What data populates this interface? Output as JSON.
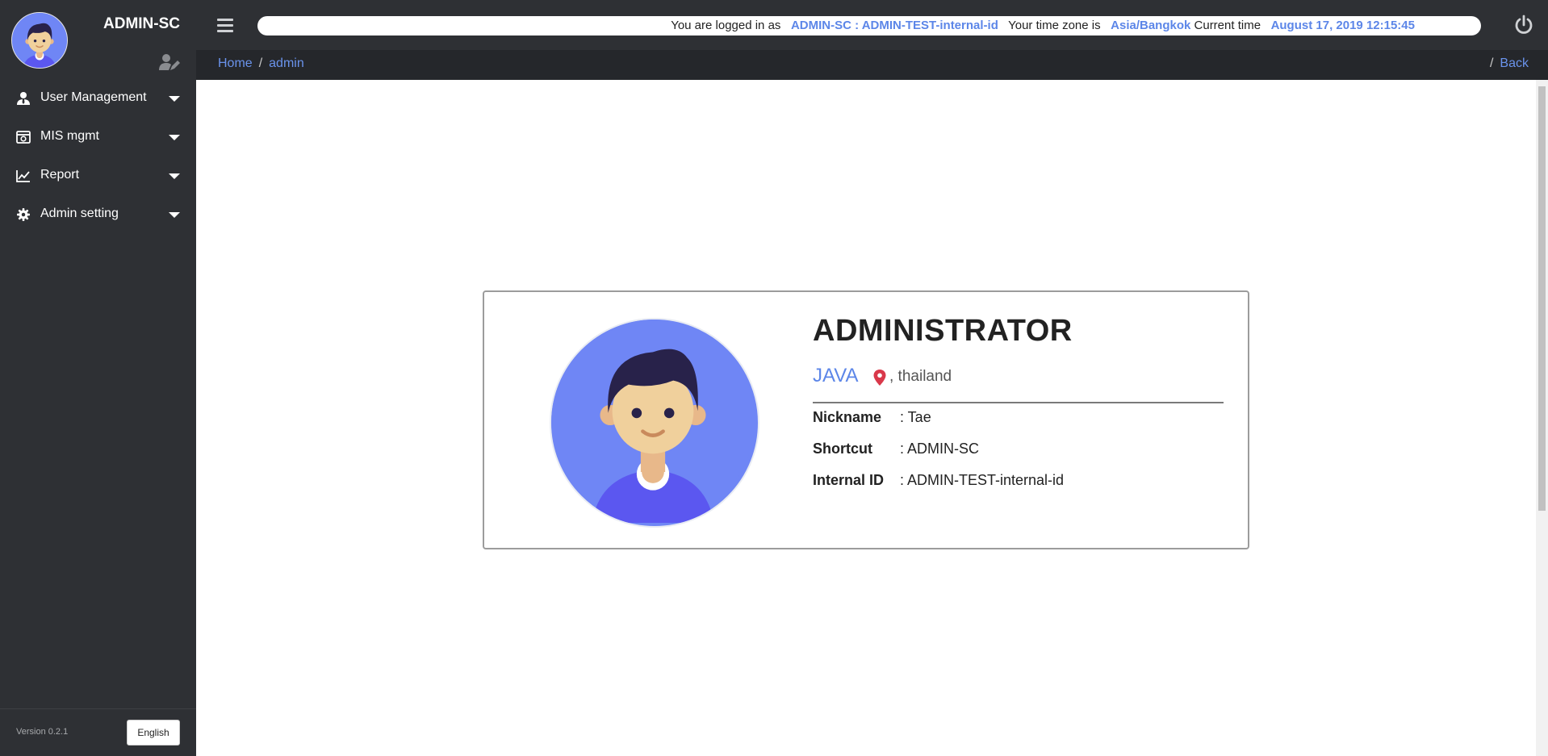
{
  "sidebar": {
    "title": "ADMIN-SC",
    "menu": [
      {
        "label": "User Management",
        "icon": "user-tie-icon"
      },
      {
        "label": "MIS mgmt",
        "icon": "server-icon"
      },
      {
        "label": "Report",
        "icon": "chart-line-icon"
      },
      {
        "label": "Admin setting",
        "icon": "gear-icon"
      }
    ],
    "version": "Version 0.2.1",
    "language": "English"
  },
  "topbar": {
    "logged_in_prefix": "You are logged in as",
    "user": "ADMIN-SC : ADMIN-TEST-internal-id",
    "timezone_prefix": "Your time zone is",
    "timezone": "Asia/Bangkok",
    "time_prefix": "Current time",
    "current_time": "August 17, 2019 12:15:45"
  },
  "breadcrumb": {
    "home": "Home",
    "current": "admin",
    "separator": "/",
    "back": "Back"
  },
  "profile": {
    "name": "ADMINISTRATOR",
    "job": "JAVA",
    "location": ", thailand",
    "fields": [
      {
        "key": "Nickname",
        "value": ": Tae"
      },
      {
        "key": "Shortcut",
        "value": ": ADMIN-SC"
      },
      {
        "key": "Internal ID",
        "value": ": ADMIN-TEST-internal-id"
      }
    ]
  },
  "colors": {
    "sidebar_bg": "#2e3034",
    "accent": "#5c86e8",
    "avatar_bg": "#6f86f5",
    "pin": "#d9384a"
  }
}
